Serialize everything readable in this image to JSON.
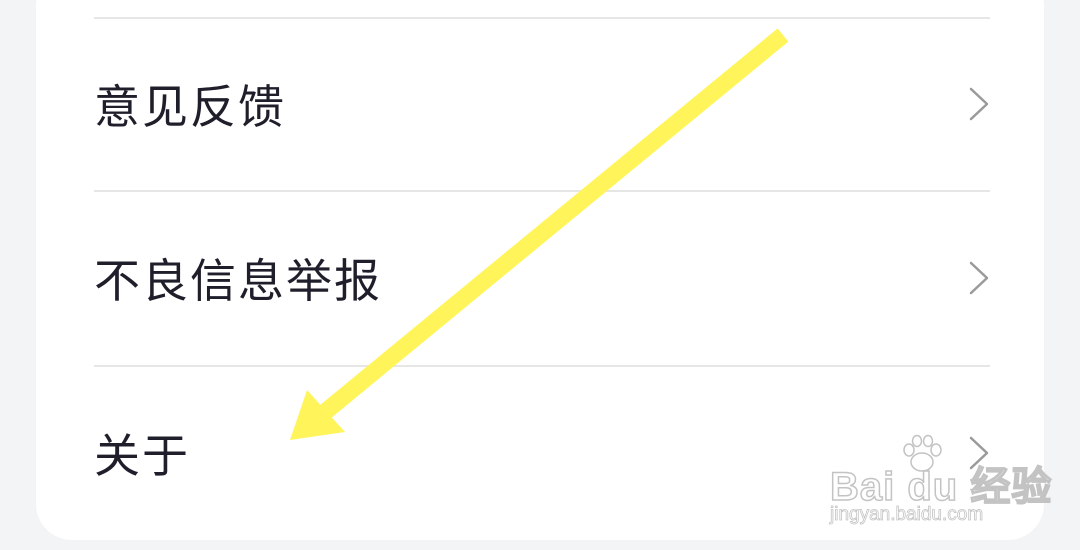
{
  "menu": {
    "items": [
      {
        "label": "意见反馈"
      },
      {
        "label": "不良信息举报"
      },
      {
        "label": "关于"
      }
    ]
  },
  "colors": {
    "background": "#f3f4f6",
    "card": "#ffffff",
    "text": "#1f1f2b",
    "divider": "#e6e6e6",
    "chevron": "#9a9a9a",
    "annotation_arrow": "#fff55a"
  },
  "icons": {
    "row_chevron": "chevron-right-icon",
    "annotation": "annotation-arrow-icon",
    "watermark_paw": "paw-icon"
  },
  "watermark": {
    "brand": "Bai du 经验",
    "url": "jingyan.baidu.com"
  }
}
